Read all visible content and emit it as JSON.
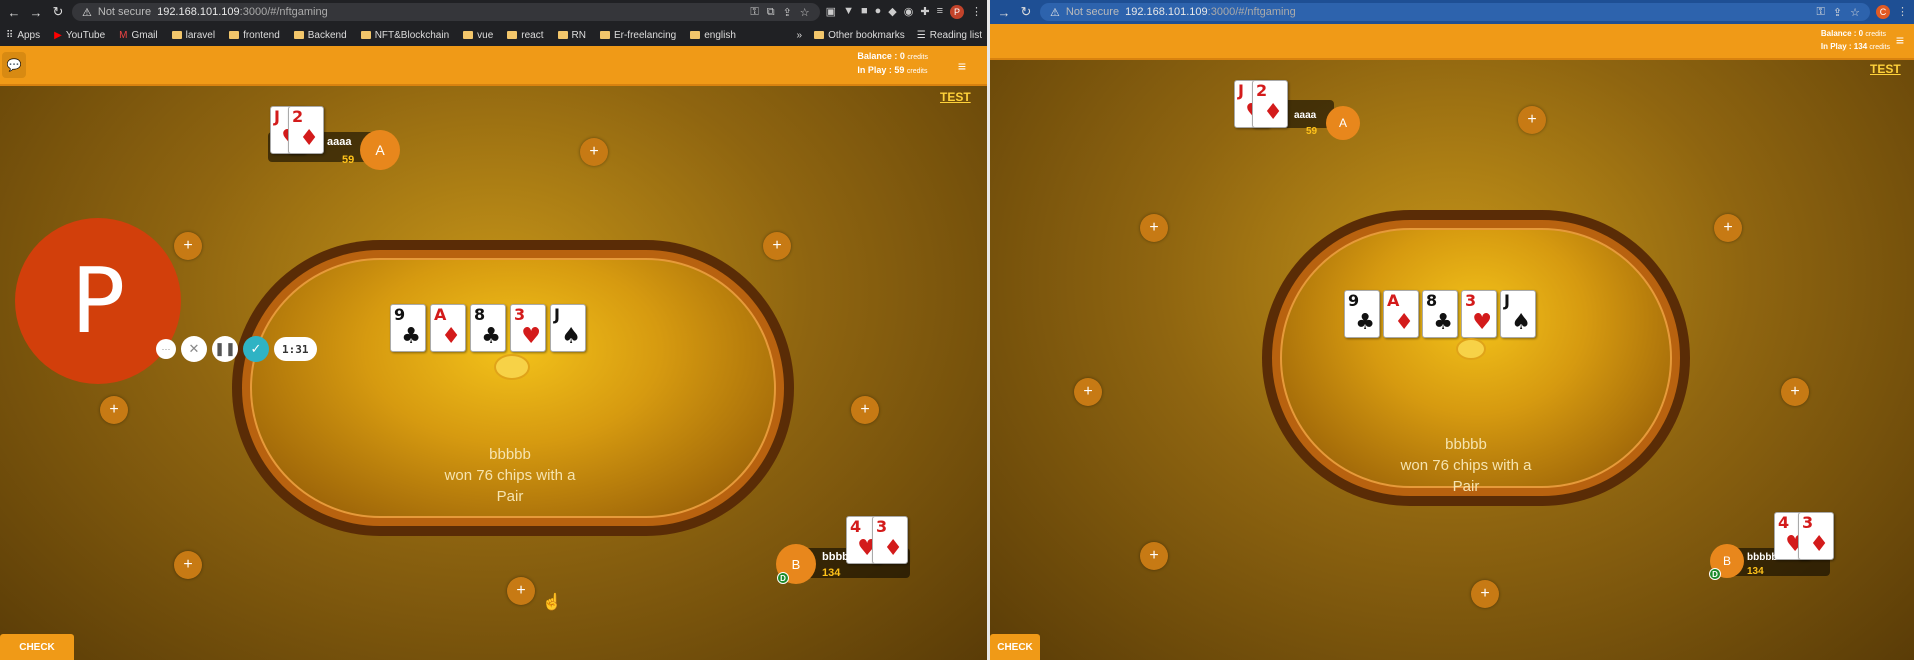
{
  "left": {
    "url_warning": "Not secure",
    "url_host": "192.168.101.109",
    "url_path": ":3000/#/nftgaming",
    "bookmarks": [
      "Apps",
      "YouTube",
      "Gmail",
      "laravel",
      "frontend",
      "Backend",
      "NFT&Blockchain",
      "vue",
      "react",
      "RN",
      "Er-freelancing",
      "english"
    ],
    "bookmarks_right": [
      "Other bookmarks",
      "Reading list"
    ],
    "profile_initial": "P",
    "balance_label": "Balance : 0",
    "inplay_label": "In Play : 59",
    "credits": "credits",
    "test_label": "TEST",
    "player_a": {
      "initial": "A",
      "name": "aaaa",
      "chips": "59",
      "cards": [
        {
          "rank": "J",
          "suit": "♥",
          "color": "red"
        },
        {
          "rank": "2",
          "suit": "♦",
          "color": "red"
        }
      ]
    },
    "player_b": {
      "initial": "B",
      "name": "bbbbb",
      "chips": "134",
      "dealer": "D",
      "cards": [
        {
          "rank": "4",
          "suit": "♥",
          "color": "red"
        },
        {
          "rank": "3",
          "suit": "♦",
          "color": "red"
        }
      ]
    },
    "community": [
      {
        "rank": "9",
        "suit": "♣",
        "color": "blk"
      },
      {
        "rank": "A",
        "suit": "♦",
        "color": "red"
      },
      {
        "rank": "8",
        "suit": "♣",
        "color": "blk"
      },
      {
        "rank": "3",
        "suit": "♥",
        "color": "red"
      },
      {
        "rank": "J",
        "suit": "♠",
        "color": "blk"
      }
    ],
    "winner_line1": "bbbbb",
    "winner_line2": "won 76 chips with a",
    "winner_line3": "Pair",
    "big_avatar": "P",
    "timer": "1:31",
    "check_label": "CHECK",
    "empty_seat_symbol": "+"
  },
  "right": {
    "url_warning": "Not secure",
    "url_host": "192.168.101.109",
    "url_path": ":3000/#/nftgaming",
    "profile_initial": "C",
    "balance_label": "Balance : 0",
    "inplay_label": "In Play : 134",
    "credits": "credits",
    "test_label": "TEST",
    "player_a": {
      "initial": "A",
      "name": "aaaa",
      "chips": "59",
      "cards": [
        {
          "rank": "J",
          "suit": "♥",
          "color": "red"
        },
        {
          "rank": "2",
          "suit": "♦",
          "color": "red"
        }
      ]
    },
    "player_b": {
      "initial": "B",
      "name": "bbbbb",
      "chips": "134",
      "dealer": "D",
      "cards": [
        {
          "rank": "4",
          "suit": "♥",
          "color": "red"
        },
        {
          "rank": "3",
          "suit": "♦",
          "color": "red"
        }
      ]
    },
    "community": [
      {
        "rank": "9",
        "suit": "♣",
        "color": "blk"
      },
      {
        "rank": "A",
        "suit": "♦",
        "color": "red"
      },
      {
        "rank": "8",
        "suit": "♣",
        "color": "blk"
      },
      {
        "rank": "3",
        "suit": "♥",
        "color": "red"
      },
      {
        "rank": "J",
        "suit": "♠",
        "color": "blk"
      }
    ],
    "winner_line1": "bbbbb",
    "winner_line2": "won 76 chips with a",
    "winner_line3": "Pair",
    "check_label": "CHECK",
    "empty_seat_symbol": "+"
  },
  "colors": {
    "topbar": "#f09a17",
    "felt": "#f3c21a",
    "rail": "#b8620f",
    "seat": "#c77a14"
  }
}
